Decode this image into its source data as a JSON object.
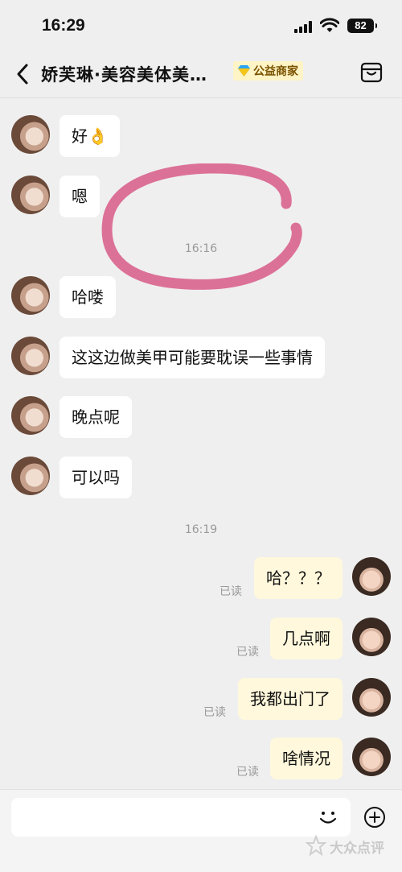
{
  "status_bar": {
    "time": "16:29",
    "battery": "82"
  },
  "header": {
    "title": "娇芙琳·美容美体美…",
    "badge": "公益商家"
  },
  "messages": [
    {
      "side": "in",
      "text": "好👌"
    },
    {
      "side": "in",
      "text": "嗯"
    },
    {
      "side": "in",
      "text": "哈喽"
    },
    {
      "side": "in",
      "text": "这这边做美甲可能要耽误一些事情"
    },
    {
      "side": "in",
      "text": "晚点呢"
    },
    {
      "side": "in",
      "text": "可以吗"
    },
    {
      "side": "out",
      "text": "哈？？？",
      "status": "已读"
    },
    {
      "side": "out",
      "text": "几点啊",
      "status": "已读"
    },
    {
      "side": "out",
      "text": "我都出门了",
      "status": "已读"
    },
    {
      "side": "out",
      "text": "啥情况",
      "status": "已读"
    }
  ],
  "timestamps": [
    "16:16",
    "16:19"
  ],
  "input": {
    "value": "",
    "placeholder": ""
  },
  "watermark": {
    "text": "大众点评"
  },
  "colors": {
    "background": "#efefef",
    "incoming_bubble": "#ffffff",
    "outgoing_bubble": "#fff8dc",
    "annotation": "#d9638e"
  }
}
